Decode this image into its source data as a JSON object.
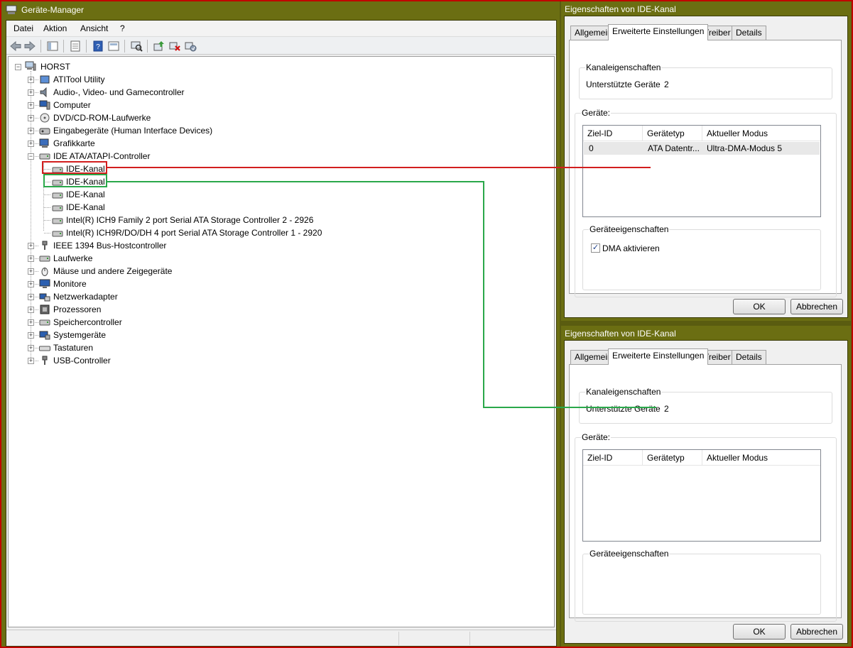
{
  "device_manager": {
    "title": "Geräte-Manager",
    "menu": [
      "Datei",
      "Aktion",
      "Ansicht",
      "?"
    ],
    "toolbar_icons": [
      "back-icon",
      "forward-icon",
      "console-tree-icon",
      "properties-icon",
      "help-icon",
      "view-icon",
      "scan-hardware-icon",
      "update-driver-icon",
      "uninstall-icon",
      "disable-icon"
    ],
    "tree": {
      "root": "HORST",
      "categories": [
        {
          "label": "ATITool Utility",
          "icon": "utility-icon"
        },
        {
          "label": "Audio-, Video- und Gamecontroller",
          "icon": "speaker-icon"
        },
        {
          "label": "Computer",
          "icon": "computer-icon"
        },
        {
          "label": "DVD/CD-ROM-Laufwerke",
          "icon": "dvd-drive-icon"
        },
        {
          "label": "Eingabegeräte (Human Interface Devices)",
          "icon": "hid-icon"
        },
        {
          "label": "Grafikkarte",
          "icon": "display-adapter-icon"
        },
        {
          "label": "IDE ATA/ATAPI-Controller",
          "icon": "ide-controller-icon"
        },
        {
          "label": "IEEE 1394 Bus-Hostcontroller",
          "icon": "firewire-icon"
        },
        {
          "label": "Laufwerke",
          "icon": "disk-drive-icon"
        },
        {
          "label": "Mäuse und andere Zeigegeräte",
          "icon": "mouse-icon"
        },
        {
          "label": "Monitore",
          "icon": "monitor-icon"
        },
        {
          "label": "Netzwerkadapter",
          "icon": "network-adapter-icon"
        },
        {
          "label": "Prozessoren",
          "icon": "processor-icon"
        },
        {
          "label": "Speichercontroller",
          "icon": "storage-controller-icon"
        },
        {
          "label": "Systemgeräte",
          "icon": "system-device-icon"
        },
        {
          "label": "Tastaturen",
          "icon": "keyboard-icon"
        },
        {
          "label": "USB-Controller",
          "icon": "usb-icon"
        }
      ],
      "ide_children": [
        "IDE-Kanal",
        "IDE-Kanal",
        "IDE-Kanal",
        "IDE-Kanal",
        "Intel(R) ICH9 Family 2 port Serial ATA Storage Controller 2 - 2926",
        "Intel(R) ICH9R/DO/DH 4 port Serial ATA Storage Controller 1 - 2920"
      ]
    },
    "highlight_colors": {
      "first": "#d21e1e",
      "second": "#2aa84a"
    }
  },
  "dialogs": [
    {
      "title": "Eigenschaften von IDE-Kanal",
      "tabs": [
        "Allgemein",
        "Erweiterte Einstellungen",
        "Treiber",
        "Details"
      ],
      "active_tab": "Erweiterte Einstellungen",
      "kanal_group": "Kanaleigenschaften",
      "unterstuetzte_label": "Unterstützte Geräte",
      "unterstuetzte_value": "2",
      "geraete_group": "Geräte:",
      "columns": [
        "Ziel-ID",
        "Gerätetyp",
        "Aktueller Modus"
      ],
      "rows": [
        [
          "0",
          "ATA Datentr...",
          "Ultra-DMA-Modus 5"
        ]
      ],
      "geraeteeigenschaften_group": "Geräteeigenschaften",
      "dma_checkbox": {
        "label": "DMA aktivieren",
        "checked": true
      },
      "ok": "OK",
      "cancel": "Abbrechen"
    },
    {
      "title": "Eigenschaften von IDE-Kanal",
      "tabs": [
        "Allgemein",
        "Erweiterte Einstellungen",
        "Treiber",
        "Details"
      ],
      "active_tab": "Erweiterte Einstellungen",
      "kanal_group": "Kanaleigenschaften",
      "unterstuetzte_label": "Unterstützte Geräte",
      "unterstuetzte_value": "2",
      "geraete_group": "Geräte:",
      "columns": [
        "Ziel-ID",
        "Gerätetyp",
        "Aktueller Modus"
      ],
      "rows": [],
      "geraeteeigenschaften_group": "Geräteeigenschaften",
      "ok": "OK",
      "cancel": "Abbrechen"
    }
  ]
}
